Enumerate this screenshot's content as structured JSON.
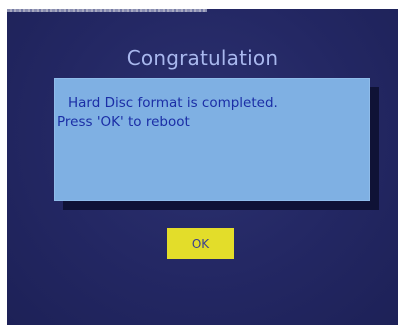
{
  "dialog": {
    "title": "Congratulation",
    "message_line1": "Hard Disc format is completed.",
    "message_line2": "Press 'OK' to reboot",
    "ok_label": "OK"
  },
  "colors": {
    "background": "#232763",
    "title_text": "#a9b8ee",
    "dialog_fill": "#7fb0e3",
    "message_text": "#1b2ea6",
    "button_fill": "#e3dd2a",
    "button_text": "#3a3f8f"
  }
}
